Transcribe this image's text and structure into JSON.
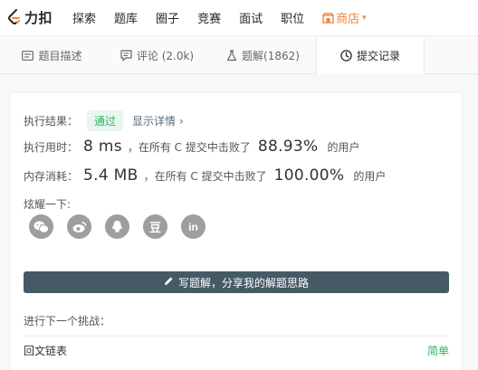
{
  "nav": {
    "logo_text": "力扣",
    "items": [
      "探索",
      "题库",
      "圈子",
      "竞赛",
      "面试",
      "职位"
    ],
    "shop_label": "商店",
    "shop_color": "#f0883e"
  },
  "tabs": [
    {
      "label": "题目描述",
      "icon": "document-icon"
    },
    {
      "label": "评论 (2.0k)",
      "icon": "comment-icon"
    },
    {
      "label": "题解(1862)",
      "icon": "flask-icon"
    },
    {
      "label": "提交记录",
      "icon": "clock-icon"
    }
  ],
  "result": {
    "label": "执行结果：",
    "status": "通过",
    "detail_link": "显示详情 ›"
  },
  "runtime": {
    "label": "执行用时：",
    "value": "8 ms",
    "middle": "，在所有 C 提交中击败了",
    "percent": "88.93%",
    "suffix": "的用户"
  },
  "memory": {
    "label": "内存消耗：",
    "value": "5.4 MB",
    "middle": "，在所有 C 提交中击败了",
    "percent": "100.00%",
    "suffix": "的用户"
  },
  "share": {
    "label": "炫耀一下:",
    "icons": [
      "wechat-icon",
      "weibo-icon",
      "qq-icon",
      "douban-icon",
      "linkedin-icon"
    ],
    "douban_char": "豆",
    "linkedin_text": "in"
  },
  "write_button": "写题解，分享我的解题思路",
  "next": {
    "label": "进行下一个挑战：",
    "problem": "回文链表",
    "difficulty": "简单",
    "difficulty_color": "#2db55d"
  },
  "colors": {
    "accent_dark": "#455a64",
    "pass_green": "#2db55d"
  }
}
